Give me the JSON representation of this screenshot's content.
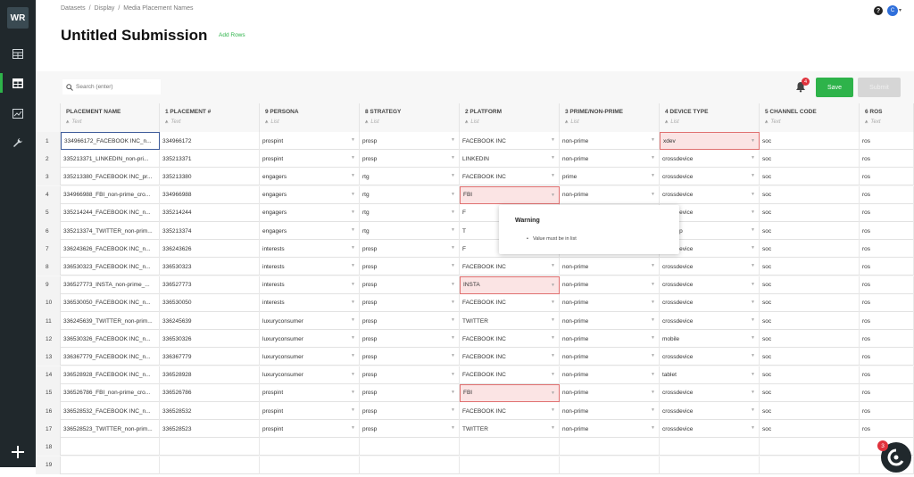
{
  "sidebar": {
    "logo": "WR"
  },
  "breadcrumb": [
    "Datasets",
    "/",
    "Display",
    "/",
    "Media Placement Names"
  ],
  "page": {
    "title": "Untitled Submission",
    "add_rows": "Add Rows"
  },
  "header": {
    "help": "?",
    "user_initial": "C"
  },
  "toolbar": {
    "search_placeholder": "Search (enter)",
    "notification_count": "4",
    "save_label": "Save",
    "submit_label": "Submit"
  },
  "columns": [
    {
      "name": "PLACEMENT NAME",
      "type": "Text"
    },
    {
      "name": "1 PLACEMENT #",
      "type": "Text"
    },
    {
      "name": "9 PERSONA",
      "type": "List"
    },
    {
      "name": "8 STRATEGY",
      "type": "List"
    },
    {
      "name": "2 PLATFORM",
      "type": "List"
    },
    {
      "name": "3 PRIME/NON-PRIME",
      "type": "List"
    },
    {
      "name": "4 DEVICE TYPE",
      "type": "List"
    },
    {
      "name": "5 CHANNEL CODE",
      "type": "Text"
    },
    {
      "name": "6 ROS",
      "type": "Text"
    }
  ],
  "rows": [
    {
      "n": "1",
      "cells": [
        "334966172_FACEBOOK INC_n...",
        "334966172",
        "prospint",
        "prosp",
        "FACEBOOK INC",
        "non-prime",
        "xdev",
        "soc",
        "ros"
      ]
    },
    {
      "n": "2",
      "cells": [
        "335213371_LINKEDIN_non-pri...",
        "335213371",
        "prospint",
        "prosp",
        "LINKEDIN",
        "non-prime",
        "crossdevice",
        "soc",
        "ros"
      ]
    },
    {
      "n": "3",
      "cells": [
        "335213380_FACEBOOK INC_pr...",
        "335213380",
        "engagers",
        "rtg",
        "FACEBOOK INC",
        "prime",
        "crossdevice",
        "soc",
        "ros"
      ]
    },
    {
      "n": "4",
      "cells": [
        "334966988_FBI_non-prime_cro...",
        "334966988",
        "engagers",
        "rtg",
        "FBI",
        "non-prime",
        "crossdevice",
        "soc",
        "ros"
      ]
    },
    {
      "n": "5",
      "cells": [
        "335214244_FACEBOOK INC_n...",
        "335214244",
        "engagers",
        "rtg",
        "F",
        "",
        "crossdevice",
        "soc",
        "ros"
      ]
    },
    {
      "n": "6",
      "cells": [
        "335213374_TWITTER_non-prim...",
        "335213374",
        "engagers",
        "rtg",
        "T",
        "",
        "desktop",
        "soc",
        "ros"
      ]
    },
    {
      "n": "7",
      "cells": [
        "336243626_FACEBOOK INC_n...",
        "336243626",
        "interests",
        "prosp",
        "F",
        "",
        "crossdevice",
        "soc",
        "ros"
      ]
    },
    {
      "n": "8",
      "cells": [
        "336530323_FACEBOOK INC_n...",
        "336530323",
        "interests",
        "prosp",
        "FACEBOOK INC",
        "non-prime",
        "crossdevice",
        "soc",
        "ros"
      ]
    },
    {
      "n": "9",
      "cells": [
        "336527773_INSTA_non-prime_...",
        "336527773",
        "interests",
        "prosp",
        "INSTA",
        "non-prime",
        "crossdevice",
        "soc",
        "ros"
      ]
    },
    {
      "n": "10",
      "cells": [
        "336530050_FACEBOOK INC_n...",
        "336530050",
        "interests",
        "prosp",
        "FACEBOOK INC",
        "non-prime",
        "crossdevice",
        "soc",
        "ros"
      ]
    },
    {
      "n": "11",
      "cells": [
        "336245639_TWITTER_non-prim...",
        "336245639",
        "luxuryconsumer",
        "prosp",
        "TWITTER",
        "non-prime",
        "crossdevice",
        "soc",
        "ros"
      ]
    },
    {
      "n": "12",
      "cells": [
        "336530326_FACEBOOK INC_n...",
        "336530326",
        "luxuryconsumer",
        "prosp",
        "FACEBOOK INC",
        "non-prime",
        "mobile",
        "soc",
        "ros"
      ]
    },
    {
      "n": "13",
      "cells": [
        "336367779_FACEBOOK INC_n...",
        "336367779",
        "luxuryconsumer",
        "prosp",
        "FACEBOOK INC",
        "non-prime",
        "crossdevice",
        "soc",
        "ros"
      ]
    },
    {
      "n": "14",
      "cells": [
        "336528928_FACEBOOK INC_n...",
        "336528928",
        "luxuryconsumer",
        "prosp",
        "FACEBOOK INC",
        "non-prime",
        "tablet",
        "soc",
        "ros"
      ]
    },
    {
      "n": "15",
      "cells": [
        "336526786_FBI_non-prime_cro...",
        "336526786",
        "prospint",
        "prosp",
        "FBI",
        "non-prime",
        "crossdevice",
        "soc",
        "ros"
      ]
    },
    {
      "n": "16",
      "cells": [
        "336528532_FACEBOOK INC_n...",
        "336528532",
        "prospint",
        "prosp",
        "FACEBOOK INC",
        "non-prime",
        "crossdevice",
        "soc",
        "ros"
      ]
    },
    {
      "n": "17",
      "cells": [
        "336528523_TWITTER_non-prim...",
        "336528523",
        "prospint",
        "prosp",
        "TWITTER",
        "non-prime",
        "crossdevice",
        "soc",
        "ros"
      ]
    },
    {
      "n": "18",
      "cells": [
        "",
        "",
        "",
        "",
        "",
        "",
        "",
        "",
        ""
      ]
    },
    {
      "n": "19",
      "cells": [
        "",
        "",
        "",
        "",
        "",
        "",
        "",
        "",
        ""
      ]
    }
  ],
  "error_cells": [
    [
      0,
      6
    ],
    [
      3,
      4
    ],
    [
      8,
      4
    ],
    [
      14,
      4
    ]
  ],
  "selected_cell": [
    0,
    0
  ],
  "warning": {
    "title": "Warning",
    "message": "Value must be in list"
  },
  "chat": {
    "badge": "3"
  },
  "colors": {
    "accent": "#2eb34a",
    "sidebar": "#20282c",
    "error_bg": "#fbe4e4",
    "error_border": "#e07070",
    "badge": "#e0323c"
  }
}
